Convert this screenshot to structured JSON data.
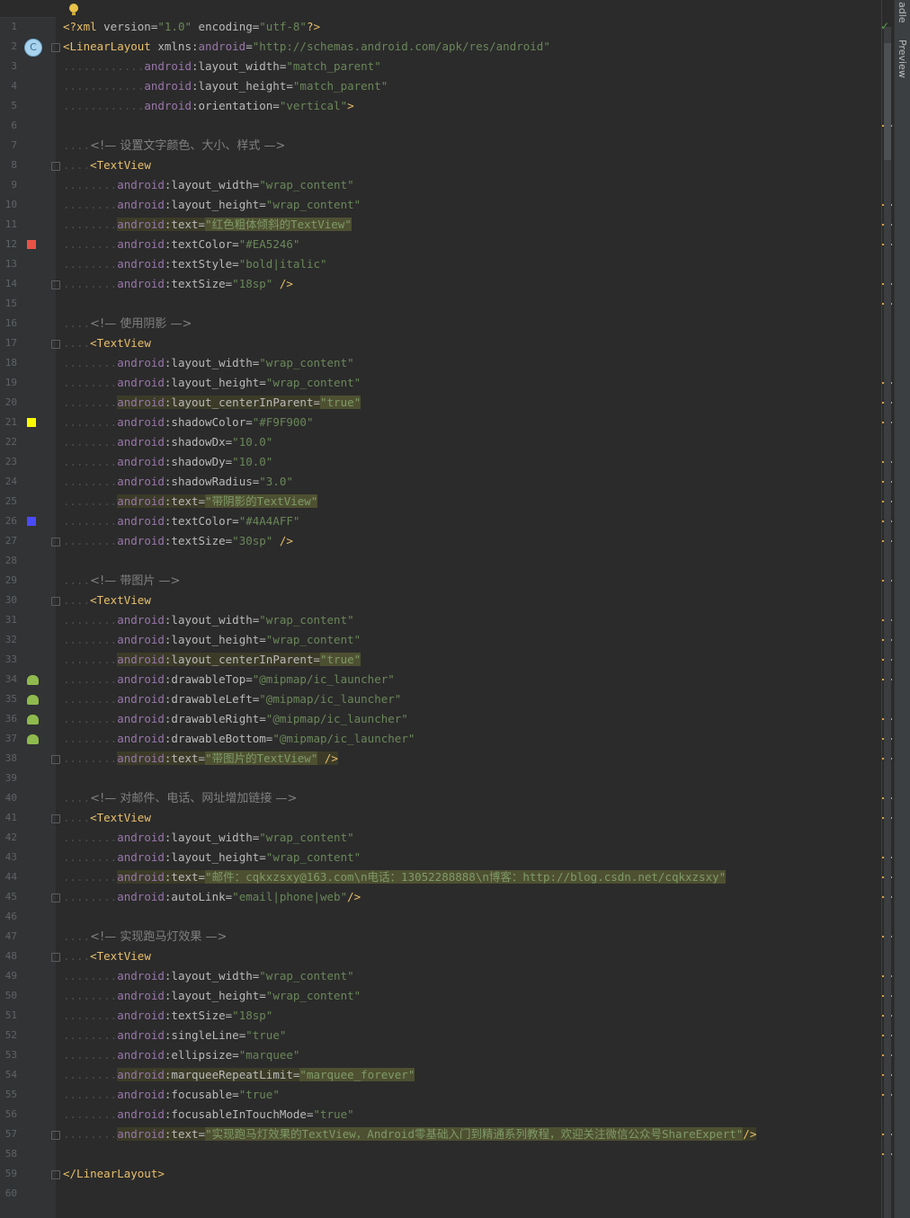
{
  "right_panel": {
    "tab_gradle": "adle",
    "tab_preview": "Preview"
  },
  "status_check": "✓",
  "lines": [
    {
      "n": "1",
      "parts": [
        {
          "c": "tag",
          "t": "<?xml "
        },
        {
          "c": "attr",
          "t": "version="
        },
        {
          "c": "val",
          "t": "\"1.0\""
        },
        {
          "c": "attr",
          "t": " encoding="
        },
        {
          "c": "val",
          "t": "\"utf-8\""
        },
        {
          "c": "tag",
          "t": "?>"
        }
      ]
    },
    {
      "n": "2",
      "gutter": "classic",
      "fold": true,
      "parts": [
        {
          "c": "tag",
          "t": "<LinearLayout "
        },
        {
          "c": "attr",
          "t": "xmlns:"
        },
        {
          "c": "ns",
          "t": "android"
        },
        {
          "c": "attr",
          "t": "="
        },
        {
          "c": "val",
          "t": "\"http://schemas.android.com/apk/res/android\""
        }
      ]
    },
    {
      "n": "3",
      "indent": "............",
      "parts": [
        {
          "c": "ns",
          "t": "android"
        },
        {
          "c": "attr",
          "t": ":layout_width="
        },
        {
          "c": "val",
          "t": "\"match_parent\""
        }
      ]
    },
    {
      "n": "4",
      "indent": "............",
      "parts": [
        {
          "c": "ns",
          "t": "android"
        },
        {
          "c": "attr",
          "t": ":layout_height="
        },
        {
          "c": "val",
          "t": "\"match_parent\""
        }
      ]
    },
    {
      "n": "5",
      "indent": "............",
      "parts": [
        {
          "c": "ns",
          "t": "android"
        },
        {
          "c": "attr",
          "t": ":orientation="
        },
        {
          "c": "val",
          "t": "\"vertical\""
        },
        {
          "c": "tag",
          "t": ">"
        }
      ]
    },
    {
      "n": "6",
      "parts": []
    },
    {
      "n": "7",
      "indent": "....",
      "parts": [
        {
          "c": "cmt",
          "t": "<!— 设置文字颜色、大小、样式 —>"
        }
      ]
    },
    {
      "n": "8",
      "fold": true,
      "indent": "....",
      "parts": [
        {
          "c": "tag",
          "t": "<TextView"
        }
      ]
    },
    {
      "n": "9",
      "indent": "........",
      "parts": [
        {
          "c": "ns",
          "t": "android"
        },
        {
          "c": "attr",
          "t": ":layout_width="
        },
        {
          "c": "val",
          "t": "\"wrap_content\""
        }
      ]
    },
    {
      "n": "10",
      "indent": "........",
      "parts": [
        {
          "c": "ns",
          "t": "android"
        },
        {
          "c": "attr",
          "t": ":layout_height="
        },
        {
          "c": "val",
          "t": "\"wrap_content\""
        }
      ]
    },
    {
      "n": "11",
      "indent": "........",
      "hl": true,
      "parts": [
        {
          "c": "ns",
          "t": "android"
        },
        {
          "c": "attr",
          "t": ":text="
        },
        {
          "c": "val",
          "t": "\"红色粗体倾斜的TextView\""
        }
      ]
    },
    {
      "n": "12",
      "gutter": "swatch",
      "swatch": "#EA5246",
      "indent": "........",
      "parts": [
        {
          "c": "ns",
          "t": "android"
        },
        {
          "c": "attr",
          "t": ":textColor="
        },
        {
          "c": "val",
          "t": "\"#EA5246\""
        }
      ]
    },
    {
      "n": "13",
      "indent": "........",
      "parts": [
        {
          "c": "ns",
          "t": "android"
        },
        {
          "c": "attr",
          "t": ":textStyle="
        },
        {
          "c": "val",
          "t": "\"bold|italic\""
        }
      ]
    },
    {
      "n": "14",
      "fold": true,
      "indent": "........",
      "parts": [
        {
          "c": "ns",
          "t": "android"
        },
        {
          "c": "attr",
          "t": ":textSize="
        },
        {
          "c": "val",
          "t": "\"18sp\""
        },
        {
          "c": "tag",
          "t": " />"
        }
      ]
    },
    {
      "n": "15",
      "parts": []
    },
    {
      "n": "16",
      "indent": "....",
      "parts": [
        {
          "c": "cmt",
          "t": "<!— 使用阴影 —>"
        }
      ]
    },
    {
      "n": "17",
      "fold": true,
      "indent": "....",
      "parts": [
        {
          "c": "tag",
          "t": "<TextView"
        }
      ]
    },
    {
      "n": "18",
      "indent": "........",
      "parts": [
        {
          "c": "ns",
          "t": "android"
        },
        {
          "c": "attr",
          "t": ":layout_width="
        },
        {
          "c": "val",
          "t": "\"wrap_content\""
        }
      ]
    },
    {
      "n": "19",
      "indent": "........",
      "parts": [
        {
          "c": "ns",
          "t": "android"
        },
        {
          "c": "attr",
          "t": ":layout_height="
        },
        {
          "c": "val",
          "t": "\"wrap_content\""
        }
      ]
    },
    {
      "n": "20",
      "indent": "........",
      "hl": true,
      "parts": [
        {
          "c": "ns",
          "t": "android"
        },
        {
          "c": "attr",
          "t": ":layout_centerInParent="
        },
        {
          "c": "val",
          "t": "\"true\""
        }
      ]
    },
    {
      "n": "21",
      "gutter": "swatch",
      "swatch": "#F9F900",
      "indent": "........",
      "parts": [
        {
          "c": "ns",
          "t": "android"
        },
        {
          "c": "attr",
          "t": ":shadowColor="
        },
        {
          "c": "val",
          "t": "\"#F9F900\""
        }
      ]
    },
    {
      "n": "22",
      "indent": "........",
      "parts": [
        {
          "c": "ns",
          "t": "android"
        },
        {
          "c": "attr",
          "t": ":shadowDx="
        },
        {
          "c": "val",
          "t": "\"10.0\""
        }
      ]
    },
    {
      "n": "23",
      "indent": "........",
      "parts": [
        {
          "c": "ns",
          "t": "android"
        },
        {
          "c": "attr",
          "t": ":shadowDy="
        },
        {
          "c": "val",
          "t": "\"10.0\""
        }
      ]
    },
    {
      "n": "24",
      "indent": "........",
      "parts": [
        {
          "c": "ns",
          "t": "android"
        },
        {
          "c": "attr",
          "t": ":shadowRadius="
        },
        {
          "c": "val",
          "t": "\"3.0\""
        }
      ]
    },
    {
      "n": "25",
      "indent": "........",
      "hl": true,
      "parts": [
        {
          "c": "ns",
          "t": "android"
        },
        {
          "c": "attr",
          "t": ":text="
        },
        {
          "c": "val",
          "t": "\"带阴影的TextView\""
        }
      ]
    },
    {
      "n": "26",
      "gutter": "swatch",
      "swatch": "#4A4AFF",
      "indent": "........",
      "parts": [
        {
          "c": "ns",
          "t": "android"
        },
        {
          "c": "attr",
          "t": ":textColor="
        },
        {
          "c": "val",
          "t": "\"#4A4AFF\""
        }
      ]
    },
    {
      "n": "27",
      "fold": true,
      "indent": "........",
      "parts": [
        {
          "c": "ns",
          "t": "android"
        },
        {
          "c": "attr",
          "t": ":textSize="
        },
        {
          "c": "val",
          "t": "\"30sp\""
        },
        {
          "c": "tag",
          "t": " />"
        }
      ]
    },
    {
      "n": "28",
      "parts": []
    },
    {
      "n": "29",
      "indent": "....",
      "parts": [
        {
          "c": "cmt",
          "t": "<!— 带图片 —>"
        }
      ]
    },
    {
      "n": "30",
      "fold": true,
      "indent": "....",
      "parts": [
        {
          "c": "tag",
          "t": "<TextView"
        }
      ]
    },
    {
      "n": "31",
      "indent": "........",
      "parts": [
        {
          "c": "ns",
          "t": "android"
        },
        {
          "c": "attr",
          "t": ":layout_width="
        },
        {
          "c": "val",
          "t": "\"wrap_content\""
        }
      ]
    },
    {
      "n": "32",
      "indent": "........",
      "parts": [
        {
          "c": "ns",
          "t": "android"
        },
        {
          "c": "attr",
          "t": ":layout_height="
        },
        {
          "c": "val",
          "t": "\"wrap_content\""
        }
      ]
    },
    {
      "n": "33",
      "indent": "........",
      "hl": true,
      "parts": [
        {
          "c": "ns",
          "t": "android"
        },
        {
          "c": "attr",
          "t": ":layout_centerInParent="
        },
        {
          "c": "val",
          "t": "\"true\""
        }
      ]
    },
    {
      "n": "34",
      "gutter": "droid",
      "indent": "........",
      "parts": [
        {
          "c": "ns",
          "t": "android"
        },
        {
          "c": "attr",
          "t": ":drawableTop="
        },
        {
          "c": "val",
          "t": "\"@mipmap/ic_launcher\""
        }
      ]
    },
    {
      "n": "35",
      "gutter": "droid",
      "indent": "........",
      "parts": [
        {
          "c": "ns",
          "t": "android"
        },
        {
          "c": "attr",
          "t": ":drawableLeft="
        },
        {
          "c": "val",
          "t": "\"@mipmap/ic_launcher\""
        }
      ]
    },
    {
      "n": "36",
      "gutter": "droid",
      "indent": "........",
      "parts": [
        {
          "c": "ns",
          "t": "android"
        },
        {
          "c": "attr",
          "t": ":drawableRight="
        },
        {
          "c": "val",
          "t": "\"@mipmap/ic_launcher\""
        }
      ]
    },
    {
      "n": "37",
      "gutter": "droid",
      "indent": "........",
      "parts": [
        {
          "c": "ns",
          "t": "android"
        },
        {
          "c": "attr",
          "t": ":drawableBottom="
        },
        {
          "c": "val",
          "t": "\"@mipmap/ic_launcher\""
        }
      ]
    },
    {
      "n": "38",
      "fold": true,
      "indent": "........",
      "hl": true,
      "parts": [
        {
          "c": "ns",
          "t": "android"
        },
        {
          "c": "attr",
          "t": ":text="
        },
        {
          "c": "val",
          "t": "\"带图片的TextView\""
        },
        {
          "c": "tag",
          "t": " />"
        }
      ]
    },
    {
      "n": "39",
      "parts": []
    },
    {
      "n": "40",
      "indent": "....",
      "parts": [
        {
          "c": "cmt",
          "t": "<!— 对邮件、电话、网址增加链接 —>"
        }
      ]
    },
    {
      "n": "41",
      "fold": true,
      "indent": "....",
      "parts": [
        {
          "c": "tag",
          "t": "<TextView"
        }
      ]
    },
    {
      "n": "42",
      "indent": "........",
      "parts": [
        {
          "c": "ns",
          "t": "android"
        },
        {
          "c": "attr",
          "t": ":layout_width="
        },
        {
          "c": "val",
          "t": "\"wrap_content\""
        }
      ]
    },
    {
      "n": "43",
      "indent": "........",
      "parts": [
        {
          "c": "ns",
          "t": "android"
        },
        {
          "c": "attr",
          "t": ":layout_height="
        },
        {
          "c": "val",
          "t": "\"wrap_content\""
        }
      ]
    },
    {
      "n": "44",
      "indent": "........",
      "hl": true,
      "parts": [
        {
          "c": "ns",
          "t": "android"
        },
        {
          "c": "attr",
          "t": ":text="
        },
        {
          "c": "val",
          "t": "\"邮件：cqkxzsxy@163.com\\n电话：13052288888\\n博客：http://blog.csdn.net/cqkxzsxy\""
        }
      ]
    },
    {
      "n": "45",
      "fold": true,
      "indent": "........",
      "parts": [
        {
          "c": "ns",
          "t": "android"
        },
        {
          "c": "attr",
          "t": ":autoLink="
        },
        {
          "c": "val",
          "t": "\"email|phone|web\""
        },
        {
          "c": "tag",
          "t": "/>"
        }
      ]
    },
    {
      "n": "46",
      "parts": []
    },
    {
      "n": "47",
      "indent": "....",
      "parts": [
        {
          "c": "cmt",
          "t": "<!— 实现跑马灯效果 —>"
        }
      ]
    },
    {
      "n": "48",
      "fold": true,
      "indent": "....",
      "parts": [
        {
          "c": "tag",
          "t": "<TextView"
        }
      ]
    },
    {
      "n": "49",
      "indent": "........",
      "parts": [
        {
          "c": "ns",
          "t": "android"
        },
        {
          "c": "attr",
          "t": ":layout_width="
        },
        {
          "c": "val",
          "t": "\"wrap_content\""
        }
      ]
    },
    {
      "n": "50",
      "indent": "........",
      "parts": [
        {
          "c": "ns",
          "t": "android"
        },
        {
          "c": "attr",
          "t": ":layout_height="
        },
        {
          "c": "val",
          "t": "\"wrap_content\""
        }
      ]
    },
    {
      "n": "51",
      "indent": "........",
      "parts": [
        {
          "c": "ns",
          "t": "android"
        },
        {
          "c": "attr",
          "t": ":textSize="
        },
        {
          "c": "val",
          "t": "\"18sp\""
        }
      ]
    },
    {
      "n": "52",
      "indent": "........",
      "parts": [
        {
          "c": "ns",
          "t": "android"
        },
        {
          "c": "attr",
          "t": ":singleLine="
        },
        {
          "c": "val",
          "t": "\"true\""
        }
      ]
    },
    {
      "n": "53",
      "indent": "........",
      "parts": [
        {
          "c": "ns",
          "t": "android"
        },
        {
          "c": "attr",
          "t": ":ellipsize="
        },
        {
          "c": "val",
          "t": "\"marquee\""
        }
      ]
    },
    {
      "n": "54",
      "indent": "........",
      "hl": true,
      "parts": [
        {
          "c": "ns",
          "t": "android"
        },
        {
          "c": "attr",
          "t": ":marqueeRepeatLimit="
        },
        {
          "c": "val",
          "t": "\"marquee_forever\""
        }
      ]
    },
    {
      "n": "55",
      "indent": "........",
      "parts": [
        {
          "c": "ns",
          "t": "android"
        },
        {
          "c": "attr",
          "t": ":focusable="
        },
        {
          "c": "val",
          "t": "\"true\""
        }
      ]
    },
    {
      "n": "56",
      "indent": "........",
      "parts": [
        {
          "c": "ns",
          "t": "android"
        },
        {
          "c": "attr",
          "t": ":focusableInTouchMode="
        },
        {
          "c": "val",
          "t": "\"true\""
        }
      ]
    },
    {
      "n": "57",
      "fold": true,
      "indent": "........",
      "hl": true,
      "parts": [
        {
          "c": "ns",
          "t": "android"
        },
        {
          "c": "attr",
          "t": ":text="
        },
        {
          "c": "val",
          "t": "\"实现跑马灯效果的TextView，Android零基础入门到精通系列教程，欢迎关注微信公众号ShareExpert\""
        },
        {
          "c": "tag",
          "t": "/>"
        }
      ]
    },
    {
      "n": "58",
      "parts": []
    },
    {
      "n": "59",
      "fold": true,
      "parts": [
        {
          "c": "tag",
          "t": "</LinearLayout>"
        }
      ]
    },
    {
      "n": "60",
      "parts": []
    }
  ],
  "colors": {
    "accent_marker": "#d9a23f",
    "swatch_red": "#EA5246",
    "swatch_yellow": "#F9F900",
    "swatch_blue": "#4A4AFF"
  },
  "icons": {
    "gutter_class": "c-class-icon",
    "gutter_android": "android-icon",
    "intention": "lightbulb-icon",
    "fold": "fold-icon",
    "status": "check-icon"
  }
}
